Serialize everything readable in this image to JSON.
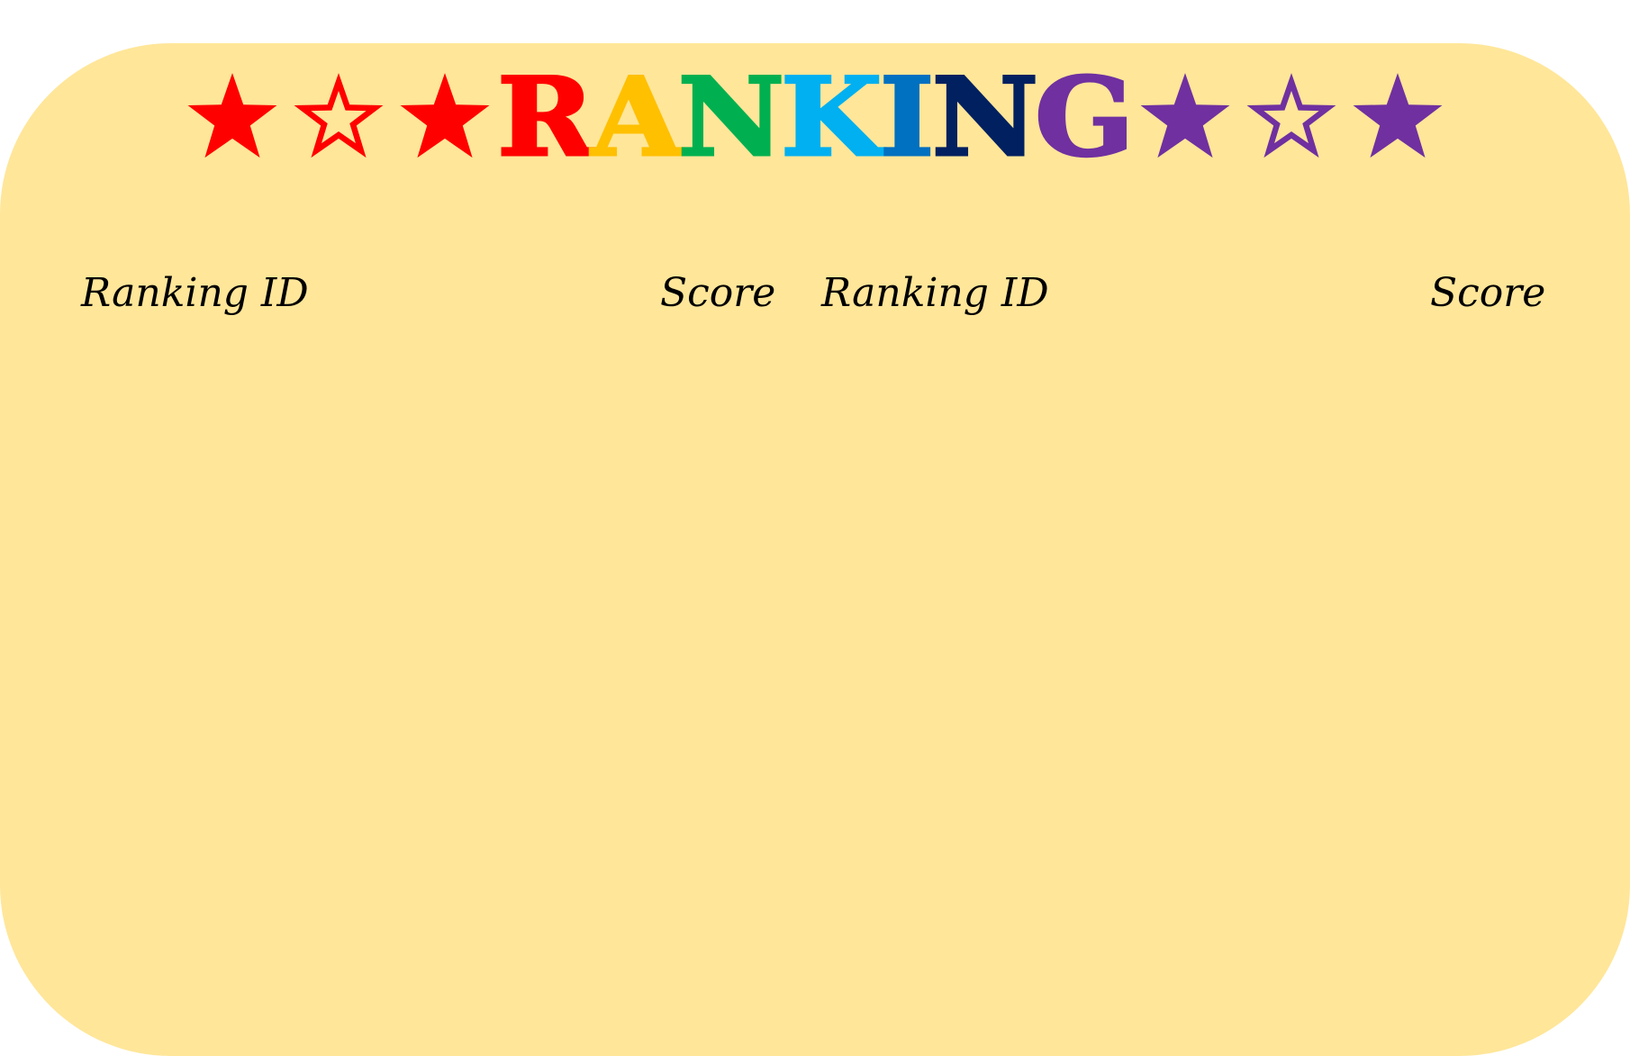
{
  "title": {
    "letters": [
      "R",
      "A",
      "N",
      "K",
      "I",
      "N",
      "G"
    ],
    "letter_colors": [
      "#ff0000",
      "#ffc000",
      "#00b050",
      "#00b0f0",
      "#0070c0",
      "#002060",
      "#7030a0"
    ],
    "left_stars": [
      {
        "icon": "star-filled",
        "color": "#ff0000"
      },
      {
        "icon": "star-outline",
        "color": "#ff0000"
      },
      {
        "icon": "star-filled",
        "color": "#ff0000"
      }
    ],
    "right_stars": [
      {
        "icon": "star-filled",
        "color": "#7030a0"
      },
      {
        "icon": "star-outline",
        "color": "#7030a0"
      },
      {
        "icon": "star-filled",
        "color": "#7030a0"
      }
    ]
  },
  "table": {
    "left": {
      "col1": "Ranking ID",
      "col2": "Score"
    },
    "right": {
      "col1": "Ranking ID",
      "col2": "Score"
    }
  },
  "colors": {
    "board_background": "#ffe699",
    "page_background": "#ffffff"
  }
}
